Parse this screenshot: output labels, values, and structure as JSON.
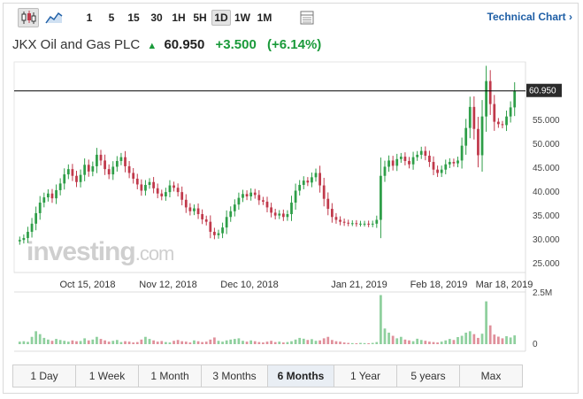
{
  "toolbar": {
    "icons": [
      "candlestick-icon",
      "area-chart-icon",
      "table-icon"
    ],
    "intervals": [
      "1",
      "5",
      "15",
      "30",
      "1H",
      "5H",
      "1D",
      "1W",
      "1M"
    ],
    "active_interval": "1D",
    "technical_link": "Technical Chart ›"
  },
  "instrument": {
    "name": "JKX Oil and Gas PLC",
    "price": "60.950",
    "change": "+3.500",
    "change_pct": "(+6.14%)",
    "direction_arrow": "▲"
  },
  "watermark": {
    "brand": "investing",
    "suffix": ".com"
  },
  "colors": {
    "up": "#2e9e48",
    "down": "#c0394b",
    "accent": "#1f5fa6",
    "price_line": "#000000"
  },
  "chart_data": {
    "type": "candlestick",
    "x_tick_labels": [
      "Oct 15, 2018",
      "Nov 12, 2018",
      "Dec 10, 2018",
      "Jan 21, 2019",
      "Feb 18, 2019",
      "Mar 18, 2019"
    ],
    "y_tick_labels": [
      "55.000",
      "50.000",
      "45.000",
      "40.000",
      "35.000",
      "30.000",
      "25.000"
    ],
    "ylim": [
      23,
      67
    ],
    "current_price_label": "60.950",
    "current_price": 60.95,
    "volume_axis_labels": [
      "2.5M",
      "0"
    ],
    "closes": [
      29.8,
      30.2,
      31.5,
      33.2,
      35.4,
      37.6,
      38.7,
      39.5,
      38.5,
      40.2,
      41.6,
      43.5,
      44.6,
      43.2,
      41.9,
      43.4,
      45.5,
      44.1,
      45.2,
      47.6,
      46.4,
      44.6,
      43.5,
      45.1,
      46.3,
      47.1,
      45.2,
      43.8,
      42.6,
      41.4,
      40.1,
      41.3,
      41.9,
      40.6,
      39.5,
      38.9,
      39.8,
      41.2,
      40.7,
      39.8,
      38.2,
      36.6,
      35.8,
      36.4,
      35.2,
      34.1,
      33.6,
      31.5,
      30.8,
      31.2,
      32.4,
      34.6,
      35.8,
      37.2,
      38.6,
      39.4,
      38.9,
      39.7,
      39.2,
      38.1,
      37.8,
      36.6,
      35.5,
      34.9,
      35.3,
      34.6,
      35.2,
      37.6,
      40.1,
      41.3,
      42.2,
      41.8,
      42.9,
      43.8,
      41.2,
      38.4,
      36.3,
      34.6,
      34.0,
      33.6,
      33.4,
      33.3,
      33.3,
      33.2,
      33.2,
      33.2,
      33.1,
      33.2,
      34.0,
      43.2,
      45.1,
      46.4,
      45.3,
      46.7,
      47.2,
      46.3,
      45.6,
      47.1,
      47.6,
      48.4,
      47.4,
      46.1,
      44.5,
      43.8,
      44.5,
      45.6,
      46.1,
      45.8,
      46.4,
      49.5,
      53.2,
      57.6,
      53.0,
      47.5,
      55.6,
      63.0,
      58.2,
      54.5,
      54.0,
      53.8,
      55.6,
      57.5,
      60.95
    ],
    "volumes": [
      0.12,
      0.14,
      0.11,
      0.35,
      0.62,
      0.48,
      0.3,
      0.22,
      0.16,
      0.25,
      0.2,
      0.16,
      0.12,
      0.18,
      0.14,
      0.15,
      0.28,
      0.18,
      0.22,
      0.35,
      0.25,
      0.18,
      0.12,
      0.16,
      0.2,
      0.1,
      0.14,
      0.12,
      0.08,
      0.1,
      0.22,
      0.35,
      0.25,
      0.18,
      0.12,
      0.15,
      0.1,
      0.08,
      0.16,
      0.2,
      0.14,
      0.12,
      0.08,
      0.18,
      0.14,
      0.1,
      0.12,
      0.22,
      0.32,
      0.16,
      0.12,
      0.18,
      0.22,
      0.25,
      0.28,
      0.16,
      0.12,
      0.18,
      0.14,
      0.1,
      0.08,
      0.12,
      0.16,
      0.1,
      0.12,
      0.08,
      0.1,
      0.14,
      0.22,
      0.3,
      0.26,
      0.2,
      0.24,
      0.16,
      0.18,
      0.28,
      0.35,
      0.2,
      0.14,
      0.12,
      0.08,
      0.06,
      0.05,
      0.04,
      0.06,
      0.05,
      0.04,
      0.06,
      0.1,
      2.35,
      0.75,
      0.55,
      0.4,
      0.28,
      0.35,
      0.22,
      0.18,
      0.14,
      0.26,
      0.2,
      0.16,
      0.12,
      0.1,
      0.08,
      0.12,
      0.18,
      0.25,
      0.2,
      0.34,
      0.4,
      0.55,
      0.62,
      0.48,
      0.3,
      0.5,
      2.05,
      0.9,
      0.46,
      0.36,
      0.28,
      0.38,
      0.32,
      0.42
    ]
  },
  "range_buttons": [
    "1 Day",
    "1 Week",
    "1 Month",
    "3 Months",
    "6 Months",
    "1 Year",
    "5 years",
    "Max"
  ],
  "active_range": "6 Months"
}
